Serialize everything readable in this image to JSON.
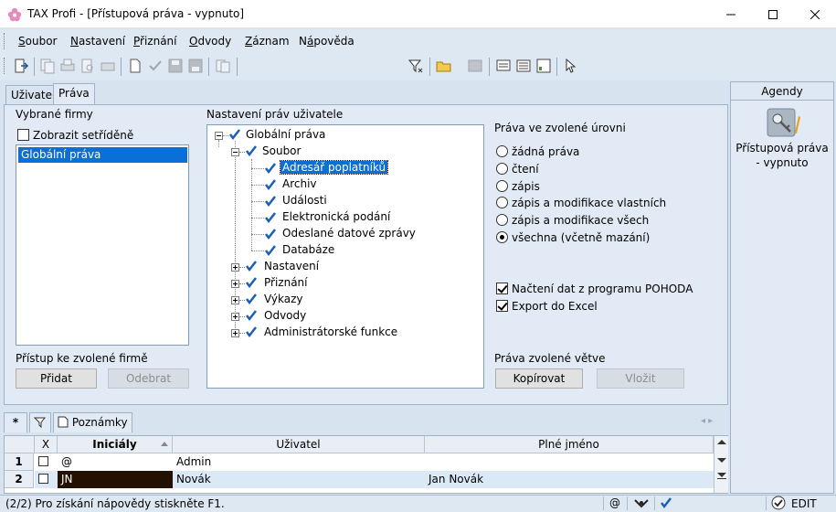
{
  "window": {
    "title": "TAX Profi - [Přístupová práva - vypnuto]"
  },
  "menu": [
    {
      "label": "Soubor",
      "key": "S"
    },
    {
      "label": "Nastavení",
      "key": "N"
    },
    {
      "label": "Přiznání",
      "key": "P"
    },
    {
      "label": "Odvody",
      "key": "O"
    },
    {
      "label": "Záznam",
      "key": "Z"
    },
    {
      "label": "Nápověda",
      "key": "á"
    }
  ],
  "toolbar": {
    "filter_value": ""
  },
  "tabs": [
    {
      "label": "Uživatel",
      "active": false
    },
    {
      "label": "Práva",
      "active": true
    }
  ],
  "left": {
    "section_label": "Vybrané firmy",
    "sort_label": "Zobrazit setříděně",
    "sort_checked": false,
    "firms": [
      "Globální práva"
    ],
    "access_label": "Přístup ke zvolené firmě",
    "add_button": "Přidat",
    "remove_button": "Odebrat"
  },
  "tree": {
    "section_label": "Nastavení práv uživatele",
    "root": "Globální práva",
    "soubor": "Soubor",
    "soubor_children": [
      "Adresář poplatníků",
      "Archiv",
      "Události",
      "Elektronická podání",
      "Odeslané datové zprávy",
      "Databáze"
    ],
    "others": [
      "Nastavení",
      "Přiznání",
      "Výkazy",
      "Odvody",
      "Administrátorské funkce"
    ]
  },
  "rights": {
    "section_label": "Práva ve zvolené úrovni",
    "options": [
      "žádná práva",
      "čtení",
      "zápis",
      "zápis a modifikace vlastních",
      "zápis a modifikace všech",
      "všechna (včetně mazání)"
    ],
    "selected_index": 5,
    "import_label": "Načtení dat z programu POHODA",
    "import_checked": true,
    "export_label": "Export do Excel",
    "export_checked": true,
    "branch_label": "Práva zvolené větve",
    "copy_button": "Kopírovat",
    "paste_button": "Vložit"
  },
  "agendy": {
    "header": "Agendy",
    "item_label": "Přístupová práva - vypnuto"
  },
  "bottom_tabs": {
    "star": "*",
    "notes": "Poznámky"
  },
  "grid": {
    "columns": [
      "X",
      "Iniciály",
      "Uživatel",
      "Plné jméno"
    ],
    "rows": [
      {
        "n": "1",
        "initials": "@",
        "user": "Admin",
        "full_name": ""
      },
      {
        "n": "2",
        "initials": "JN",
        "user": "Novák",
        "full_name": "Jan Novák"
      }
    ]
  },
  "status": {
    "text": "(2/2)  Pro získání nápovědy stiskněte F1.",
    "at": "@",
    "mode": "EDIT"
  },
  "colors": {
    "selection": "#0a6fd6",
    "check": "#1a5fb4"
  }
}
